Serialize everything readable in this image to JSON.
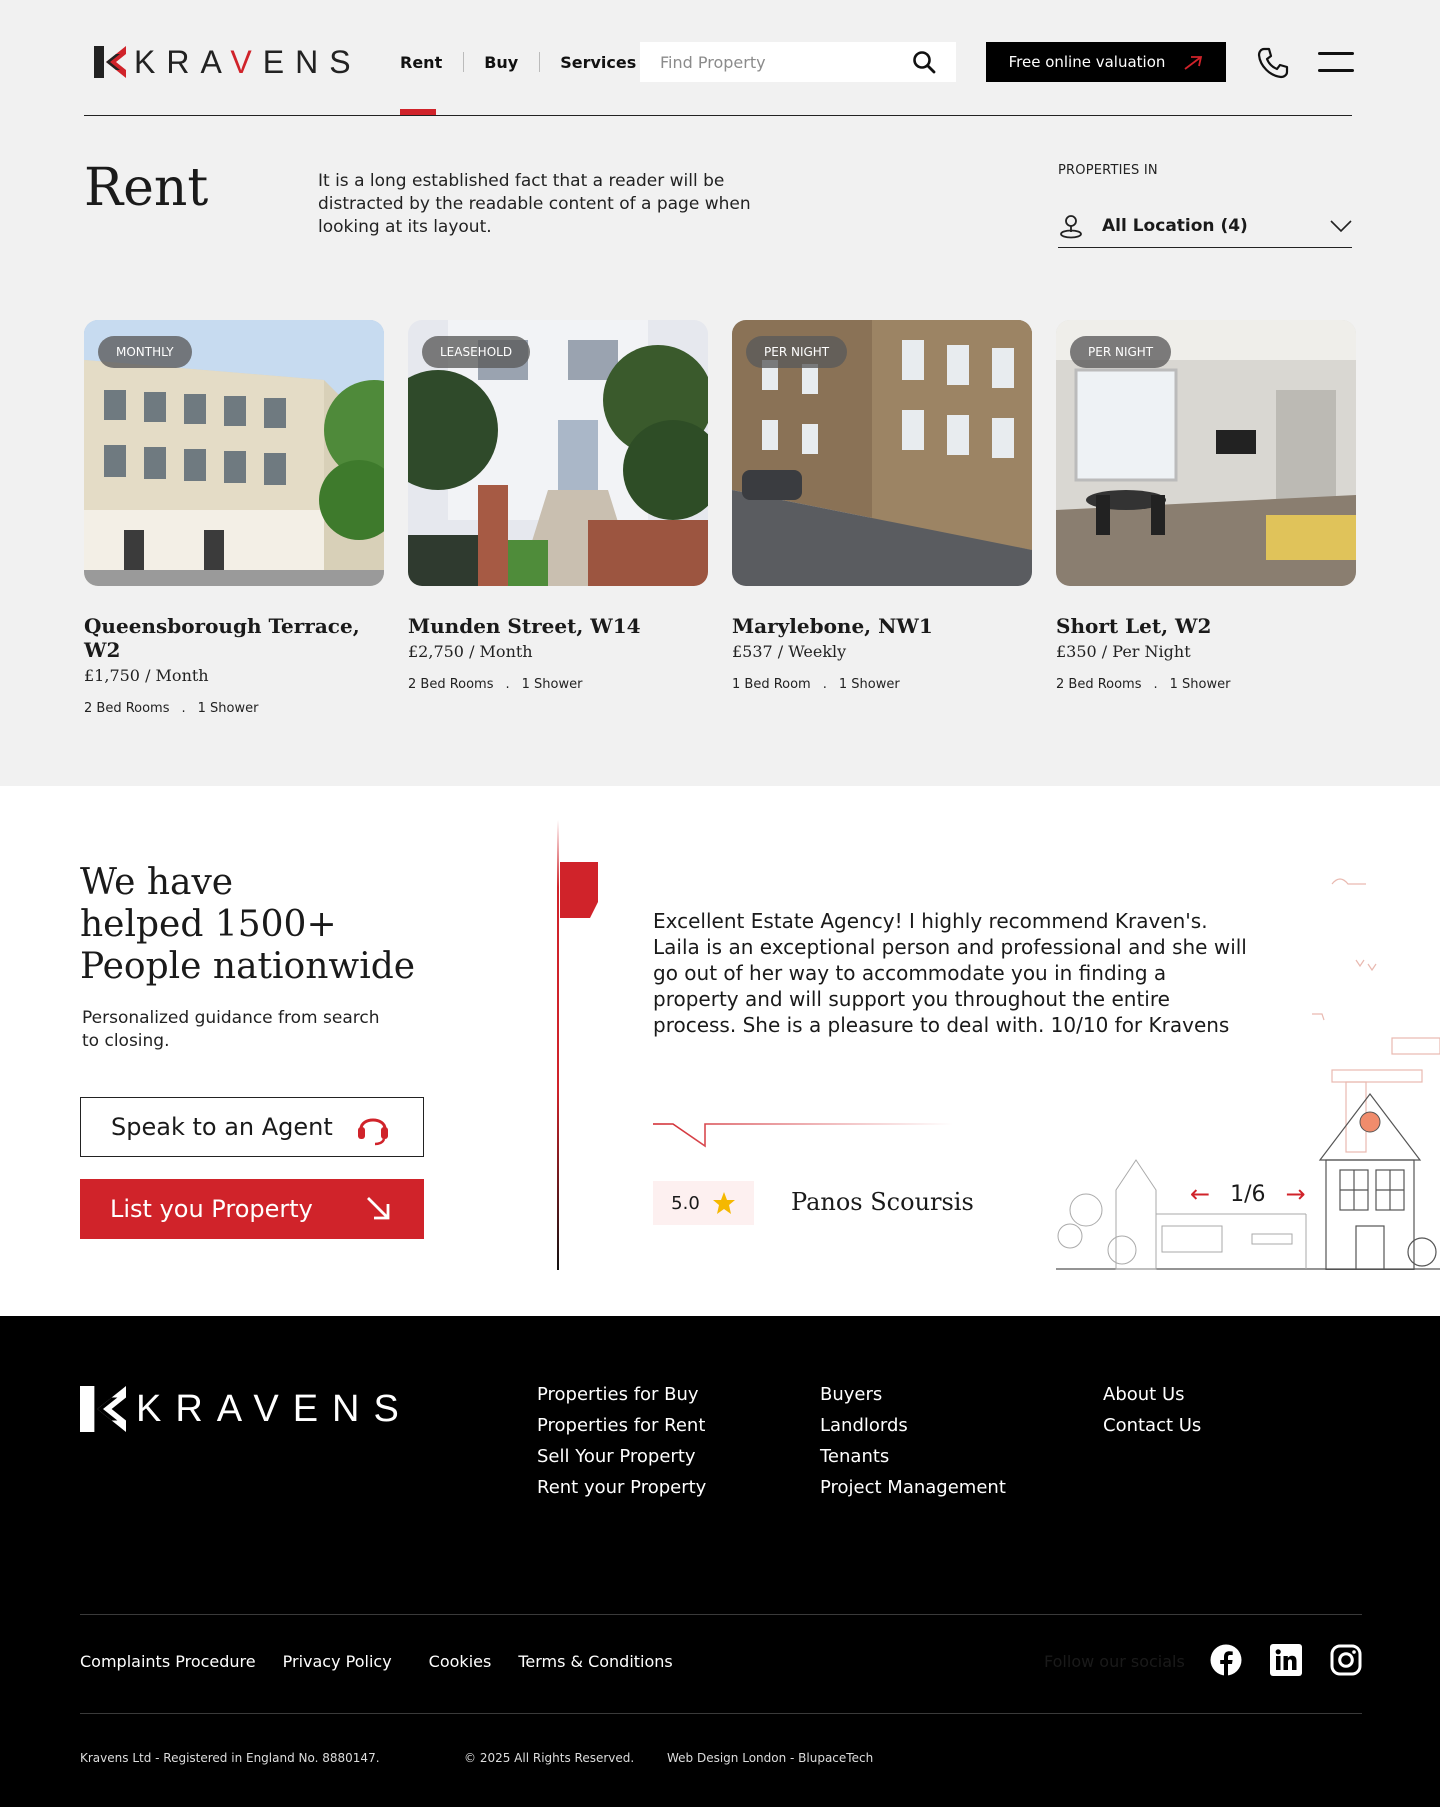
{
  "brand": {
    "name_pre": "KRA",
    "name_v": "V",
    "name_post": "ENS",
    "accent": "#d0232a"
  },
  "nav": {
    "items": [
      "Rent",
      "Buy",
      "Services"
    ],
    "active": "Rent"
  },
  "search": {
    "placeholder": "Find Property"
  },
  "valuation_button": "Free online valuation",
  "page": {
    "title": "Rent",
    "intro": "It is a long established fact that a reader will be distracted by the readable content of a page when looking at its layout.",
    "properties_in_label": "PROPERTIES IN",
    "location_select": "All Location (4)"
  },
  "listings": [
    {
      "badge": "MONTHLY",
      "name": "Queensborough Terrace, W2",
      "price": "£1,750",
      "period": "Month",
      "beds": "2 Bed Rooms",
      "baths": "1 Shower"
    },
    {
      "badge": "LEASEHOLD",
      "name": "Munden Street, W14",
      "price": "£2,750",
      "period": "Month",
      "beds": "2 Bed Rooms",
      "baths": "1 Shower"
    },
    {
      "badge": "PER NIGHT",
      "name": "Marylebone, NW1",
      "price": "£537",
      "period": "Weekly",
      "beds": "1 Bed Room",
      "baths": "1 Shower"
    },
    {
      "badge": "PER NIGHT",
      "name": "Short Let, W2",
      "price": "£350",
      "period": "Per Night",
      "beds": "2 Bed Rooms",
      "baths": "1 Shower"
    }
  ],
  "testimonials": {
    "stat_line1": "We have",
    "stat_line2": "helped 1500+",
    "stat_line3": "People nationwide",
    "subtitle": "Personalized guidance from search to closing.",
    "speak_button": "Speak to an Agent",
    "list_button": "List you Property",
    "quote": "Excellent Estate Agency! I highly recommend Kraven's. Laila is an exceptional person and professional and she will go out of her way to accommodate you in finding a property and will support you throughout the entire process. She is a pleasure to deal with. 10/10 for Kravens",
    "rating": "5.0",
    "reviewer": "Panos Scoursis",
    "pager": "1/6"
  },
  "footer": {
    "col1": [
      "Properties for Buy",
      "Properties for Rent",
      "Sell Your Property",
      "Rent your Property"
    ],
    "col2": [
      "Buyers",
      "Landlords",
      "Tenants",
      "Project Management"
    ],
    "col3": [
      "About Us",
      "Contact Us"
    ],
    "legal": [
      "Complaints Procedure",
      "Privacy Policy",
      "Cookies",
      "Terms & Conditions"
    ],
    "follow": "Follow our socials",
    "socials": [
      "facebook-icon",
      "linkedin-icon",
      "instagram-icon"
    ],
    "company": "Kravens Ltd - Registered in England No. 8880147.",
    "copyright": "© 2025 All Rights Reserved.",
    "credit": "Web Design London - BlupaceTech"
  }
}
